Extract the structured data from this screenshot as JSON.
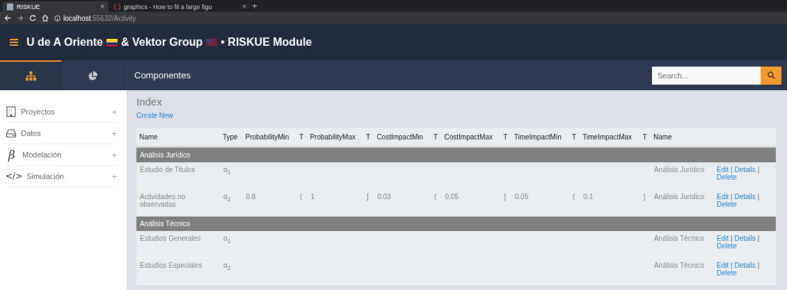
{
  "browser": {
    "tabs": [
      {
        "title": "RISKUE",
        "selected": true,
        "close": "×"
      },
      {
        "title": "graphics - How to fit a large figu",
        "selected": false,
        "close": "×"
      }
    ],
    "new_tab": "+",
    "address": {
      "host": "localhost",
      "path": ":55632/Activity"
    }
  },
  "header": {
    "title_parts": [
      "U de A Oriente",
      "& Vektor Group",
      "• RISKUE Module"
    ]
  },
  "nav": {
    "tabs": [
      {
        "kind": "sitemap",
        "selected": true
      },
      {
        "kind": "pie",
        "selected": false
      }
    ],
    "title": "Componentes",
    "search": {
      "placeholder": "Search..."
    }
  },
  "sidebar": {
    "items": [
      {
        "kind": "building",
        "label": "Proyectos",
        "expand": "+"
      },
      {
        "kind": "drive",
        "label": "Datos",
        "expand": "+"
      },
      {
        "kind": "glyph",
        "glyph": "β",
        "label": "Modelación",
        "expand": "+"
      },
      {
        "kind": "glyph",
        "glyph": "</>",
        "label": "Simulación",
        "expand": "+"
      }
    ]
  },
  "page": {
    "title": "Index",
    "create_link": "Create New"
  },
  "table": {
    "columns": [
      "Name",
      "Type",
      "ProbabilityMin",
      "T",
      "ProbabilityMax",
      "T",
      "CostImpactMin",
      "T",
      "CostImpactMax",
      "T",
      "TimeImpactMin",
      "T",
      "TimeImpactMax",
      "T",
      "Name"
    ],
    "groups": [
      {
        "name": "Análisis Jurídico",
        "rows": [
          {
            "cells": [
              "Estudio de Titulos",
              "α$_{1}$",
              "",
              "",
              "",
              "",
              "",
              "",
              "",
              "",
              "",
              "",
              "",
              "",
              "Análisis Jurídico"
            ],
            "actions": [
              {
                "kind": "link",
                "text": "Edit"
              },
              {
                "kind": "sep",
                "text": "|"
              },
              {
                "kind": "link",
                "text": "Details"
              },
              {
                "kind": "sep",
                "text": "|"
              },
              {
                "kind": "link",
                "text": "Delete"
              }
            ]
          },
          {
            "cells": [
              "Actividades no observadas",
              "α$_{2}$",
              "0.8",
              "(",
              "1",
              "]",
              "0.03",
              "(",
              "0.05",
              "]",
              "0.05",
              "(",
              "0.1",
              "]",
              "Análisis Jurídico"
            ],
            "actions": [
              {
                "kind": "link",
                "text": "Edit"
              },
              {
                "kind": "sep",
                "text": "|"
              },
              {
                "kind": "link",
                "text": "Details"
              },
              {
                "kind": "sep",
                "text": "|"
              },
              {
                "kind": "link",
                "text": "Delete"
              }
            ]
          }
        ]
      },
      {
        "name": "Análisis Técnico",
        "rows": [
          {
            "cells": [
              "Estudios Generales",
              "α$_{1}$",
              "",
              "",
              "",
              "",
              "",
              "",
              "",
              "",
              "",
              "",
              "",
              "",
              "Análisis Técnico"
            ],
            "actions": [
              {
                "kind": "link",
                "text": "Edit"
              },
              {
                "kind": "sep",
                "text": "|"
              },
              {
                "kind": "link",
                "text": "Details"
              },
              {
                "kind": "sep",
                "text": "|"
              },
              {
                "kind": "link",
                "text": "Delete"
              }
            ]
          },
          {
            "cells": [
              "Estudios Especiales",
              "α$_{2}$",
              "",
              "",
              "",
              "",
              "",
              "",
              "",
              "",
              "",
              "",
              "",
              "",
              "Análisis Técnico"
            ],
            "actions": [
              {
                "kind": "link",
                "text": "Edit"
              },
              {
                "kind": "sep",
                "text": "|"
              },
              {
                "kind": "link",
                "text": "Details"
              },
              {
                "kind": "sep",
                "text": "|"
              },
              {
                "kind": "link",
                "text": "Delete"
              }
            ]
          }
        ]
      }
    ]
  }
}
